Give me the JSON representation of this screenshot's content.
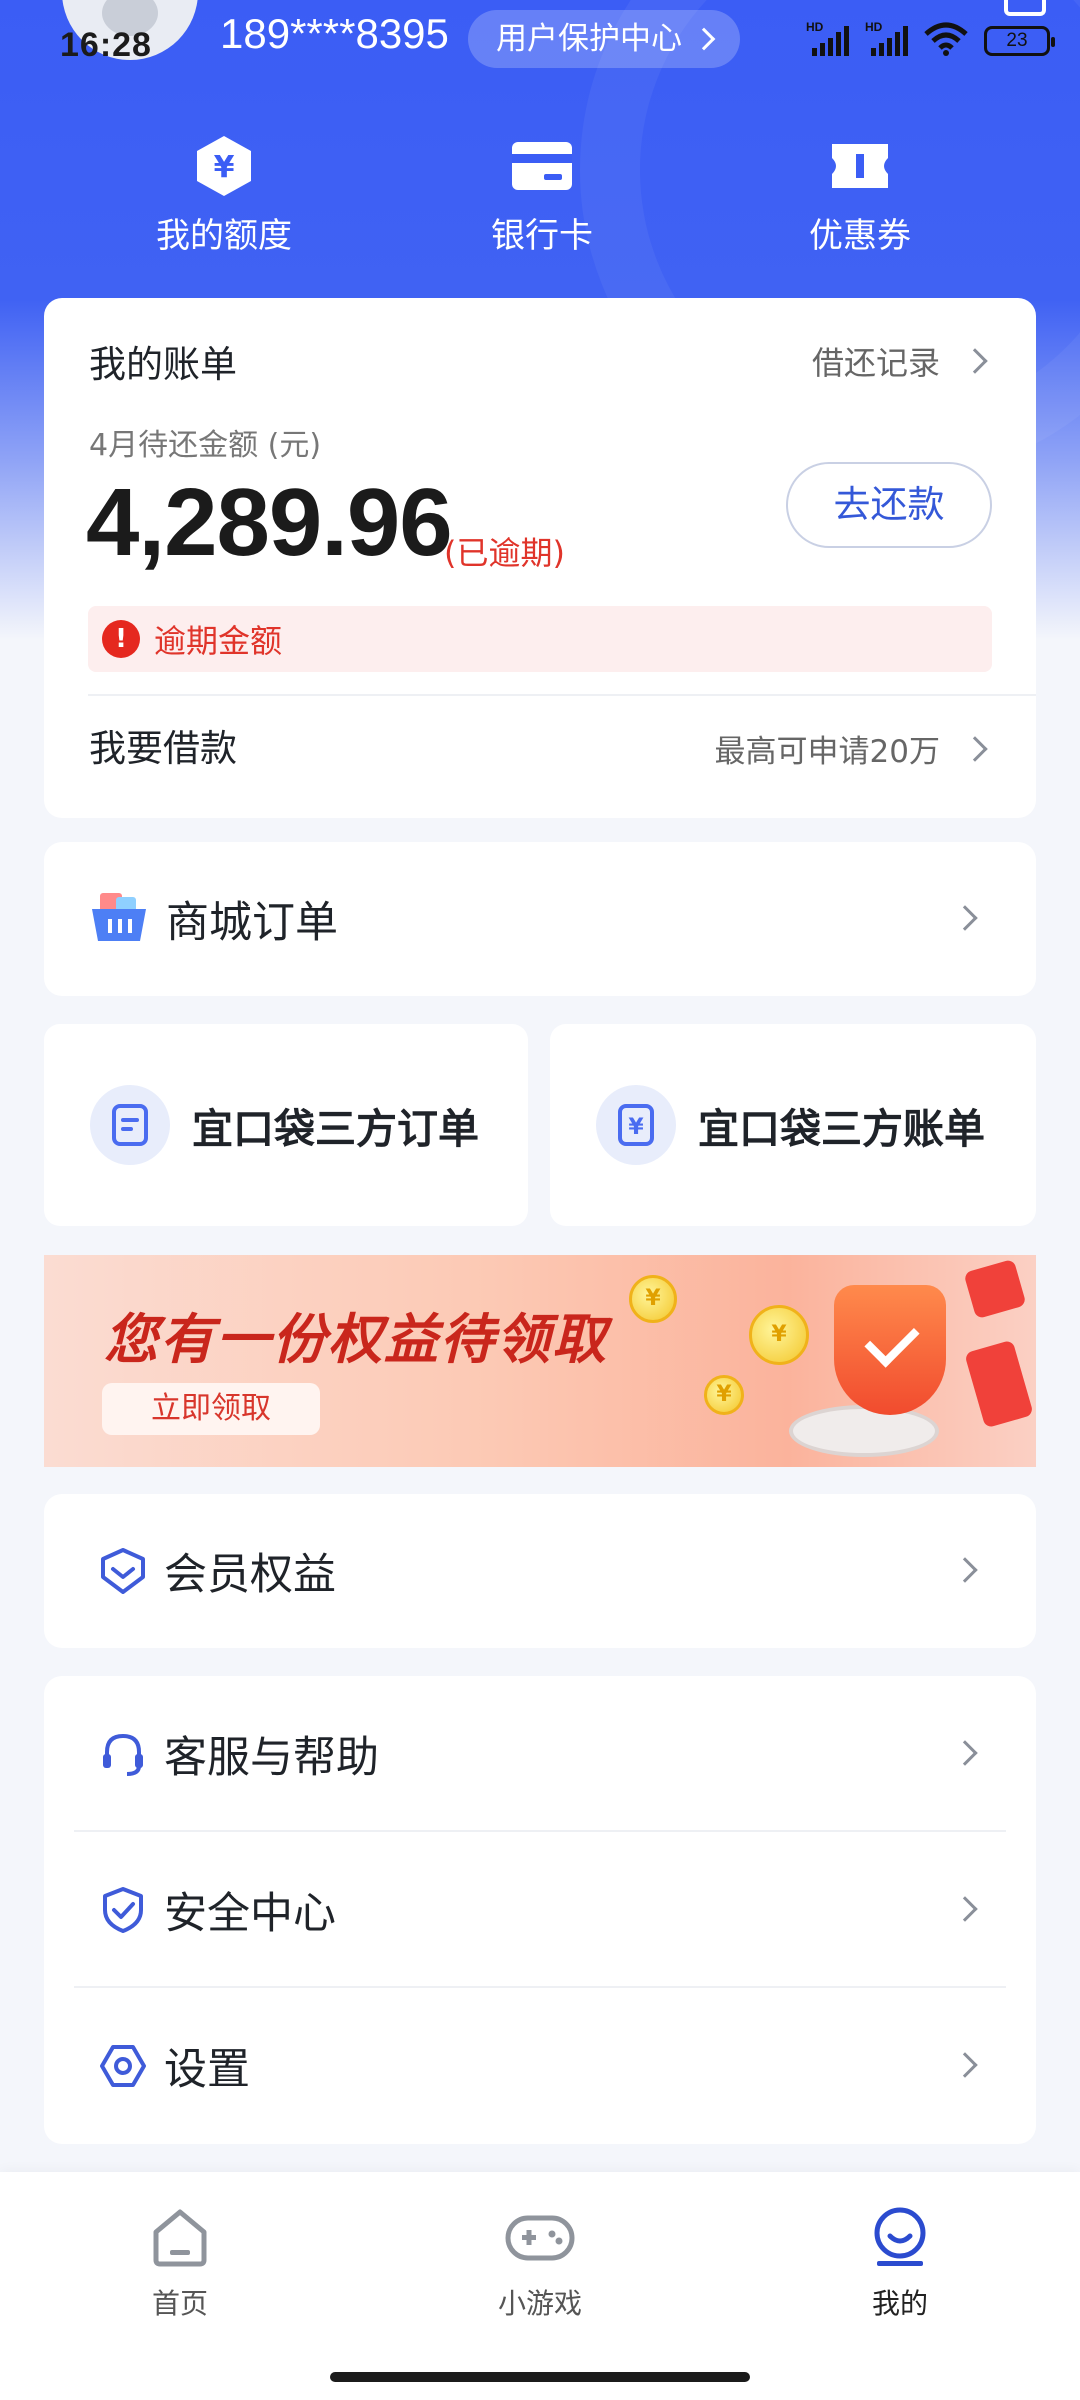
{
  "status_bar": {
    "time": "16:28",
    "battery": "23",
    "signal_badges": [
      "HD",
      "HD"
    ]
  },
  "user": {
    "phone": "189****8395",
    "protect_label": "用户保护中心"
  },
  "quick_actions": [
    {
      "label": "我的额度",
      "icon": "yuan-hexagon-icon"
    },
    {
      "label": "银行卡",
      "icon": "bank-card-icon"
    },
    {
      "label": "优惠券",
      "icon": "coupon-icon"
    }
  ],
  "bill": {
    "title": "我的账单",
    "record_label": "借还记录",
    "due_label": "4月待还金额 (元)",
    "amount": "4,289.96",
    "overdue_tag": "(已逾期)",
    "repay_button": "去还款",
    "overdue_notice": "逾期金额",
    "loan_label": "我要借款",
    "loan_hint": "最高可申请20万"
  },
  "mall": {
    "label": "商城订单",
    "icon": "shopping-basket-icon"
  },
  "third_party": [
    {
      "label": "宜口袋三方订单",
      "icon": "order-doc-icon"
    },
    {
      "label": "宜口袋三方账单",
      "icon": "yuan-bill-icon"
    }
  ],
  "banner": {
    "headline": "您有一份权益待领取",
    "cta": "立即领取"
  },
  "member": {
    "label": "会员权益",
    "icon": "member-badge-icon"
  },
  "service_menu": [
    {
      "label": "客服与帮助",
      "icon": "headset-icon"
    },
    {
      "label": "安全中心",
      "icon": "shield-check-icon"
    },
    {
      "label": "设置",
      "icon": "settings-hexagon-icon"
    }
  ],
  "tabs": [
    {
      "label": "首页",
      "icon": "home-icon"
    },
    {
      "label": "小游戏",
      "icon": "gamepad-icon"
    },
    {
      "label": "我的",
      "icon": "profile-icon",
      "active": true
    }
  ],
  "colors": {
    "brand_blue": "#3b5df5",
    "accent_blue": "#3458d8",
    "danger_red": "#e0342a"
  }
}
